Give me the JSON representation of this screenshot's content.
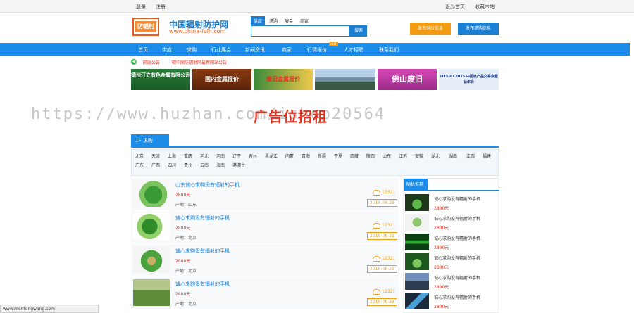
{
  "topbar": {
    "login": "登录",
    "register": "注册",
    "set_home": "设为首页",
    "bookmark": "收藏本站"
  },
  "header": {
    "logo_text": "防辐射",
    "site_name": "中国辐射防护网",
    "site_url": "www.china-fsfh.com",
    "search_tabs": [
      "供应",
      "求购",
      "展会",
      "商家"
    ],
    "search_placeholder": "",
    "search_button": "搜索",
    "publish_supply": "发布供应信息",
    "publish_buy": "发布求购信息"
  },
  "nav": {
    "items": [
      "首页",
      "供应",
      "求购",
      "行业展会",
      "新闻资讯",
      "商家",
      "行情报价",
      "人才招聘",
      "联系我们"
    ],
    "hot_badge": "HOT"
  },
  "notice": {
    "label": "网站公告",
    "text": "昭中国防辐射网最新网站公告"
  },
  "banners": [
    {
      "text": "德州汀立有色金属有限公司",
      "color": "#2b7a3a"
    },
    {
      "text": "国内金属报价",
      "color": "#8a3b12"
    },
    {
      "text": "废旧金属报价",
      "color": "#e0301e"
    },
    {
      "text": "",
      "color": "#7fa3c8"
    },
    {
      "text": "佛山废旧",
      "color": "#c83aa8"
    },
    {
      "text": "TIEXPO 2015 中国钛产品交易会暨钛年会",
      "color": "#e6eef8"
    }
  ],
  "watermark": "https://www.huzhan.com/ishop20564",
  "ad_text": "广告位招租",
  "section": {
    "title": "1F 求购",
    "regions": [
      "北京",
      "天津",
      "上海",
      "重庆",
      "河北",
      "河南",
      "辽宁",
      "吉林",
      "黑龙江",
      "内蒙",
      "青海",
      "新疆",
      "宁夏",
      "西藏",
      "陕西",
      "山东",
      "江苏",
      "安徽",
      "湖北",
      "湖南",
      "江西",
      "福建",
      "广东",
      "广西",
      "四川",
      "贵州",
      "云南",
      "海南",
      "港澳台"
    ]
  },
  "listings": [
    {
      "title": "山东诚心求购没有辐射的手机",
      "price": "2800元",
      "origin": "产地：山东",
      "phone": "12321",
      "date": "2016-08-23"
    },
    {
      "title": "诚心求购没有辐射的手机",
      "price": "2800元",
      "origin": "产地：北京",
      "phone": "12321",
      "date": "2016-08-23"
    },
    {
      "title": "诚心求购没有辐射的手机",
      "price": "2800元",
      "origin": "产地：北京",
      "phone": "12321",
      "date": "2016-08-23"
    },
    {
      "title": "诚心求购没有辐射的手机",
      "price": "2800元",
      "origin": "产地：北京",
      "phone": "12321",
      "date": "2016-08-23"
    }
  ],
  "sidebar": {
    "title": "随机推荐",
    "items": [
      {
        "title": "诚心求购没有辐射的手机",
        "price": "2800元"
      },
      {
        "title": "诚心求购没有辐射的手机",
        "price": "2800元"
      },
      {
        "title": "诚心求购没有辐射的手机",
        "price": "2800元"
      },
      {
        "title": "诚心求购没有辐射的手机",
        "price": "2800元"
      },
      {
        "title": "诚心求购没有辐射的手机",
        "price": "2800元"
      },
      {
        "title": "诚心求购没有辐射的手机",
        "price": "2800元"
      }
    ]
  },
  "status_url": "www.mentongwang.com"
}
